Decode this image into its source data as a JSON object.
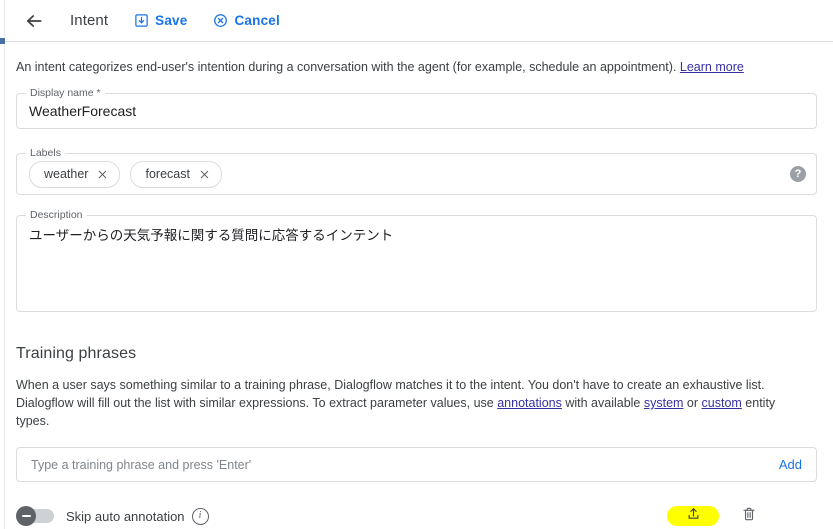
{
  "header": {
    "back_icon": "arrow-left-icon",
    "title": "Intent",
    "save_label": "Save",
    "save_icon": "save-icon",
    "cancel_label": "Cancel",
    "cancel_icon": "cancel-circle-icon"
  },
  "intro": {
    "text": "An intent categorizes end-user's intention during a conversation with the agent (for example, schedule an appointment). ",
    "link_label": "Learn more"
  },
  "display_name": {
    "legend": "Display name *",
    "value": "WeatherForecast"
  },
  "labels": {
    "legend": "Labels",
    "chips": [
      {
        "label": "weather",
        "remove_icon": "close-icon"
      },
      {
        "label": "forecast",
        "remove_icon": "close-icon"
      }
    ],
    "help_icon": "help-icon",
    "help_glyph": "?"
  },
  "description": {
    "legend": "Description",
    "value": "ユーザーからの天気予報に関する質問に応答するインテント"
  },
  "training_phrases": {
    "title": "Training phrases",
    "desc_part1": "When a user says something similar to a training phrase, Dialogflow matches it to the intent. You don't have to create an exhaustive list. Dialogflow will fill out the list with similar expressions. To extract parameter values, use ",
    "link_annotations": "annotations",
    "desc_part2": " with available ",
    "link_system": "system",
    "desc_part3": " or ",
    "link_custom": "custom",
    "desc_part4": " entity types.",
    "input_placeholder": "Type a training phrase and press 'Enter'",
    "input_value": "",
    "add_label": "Add"
  },
  "bottom": {
    "toggle_label": "Skip auto annotation",
    "toggle_state": "off",
    "info_icon": "info-icon",
    "info_glyph": "i",
    "upload_icon": "upload-icon",
    "upload_highlight_color": "#ffff00",
    "delete_icon": "trash-icon"
  },
  "colors": {
    "accent_blue": "#1a73e8",
    "link_purple": "#3730a3",
    "border_gray": "#dadce0",
    "text_primary": "#3c4043",
    "highlight_yellow": "#ffff00"
  }
}
